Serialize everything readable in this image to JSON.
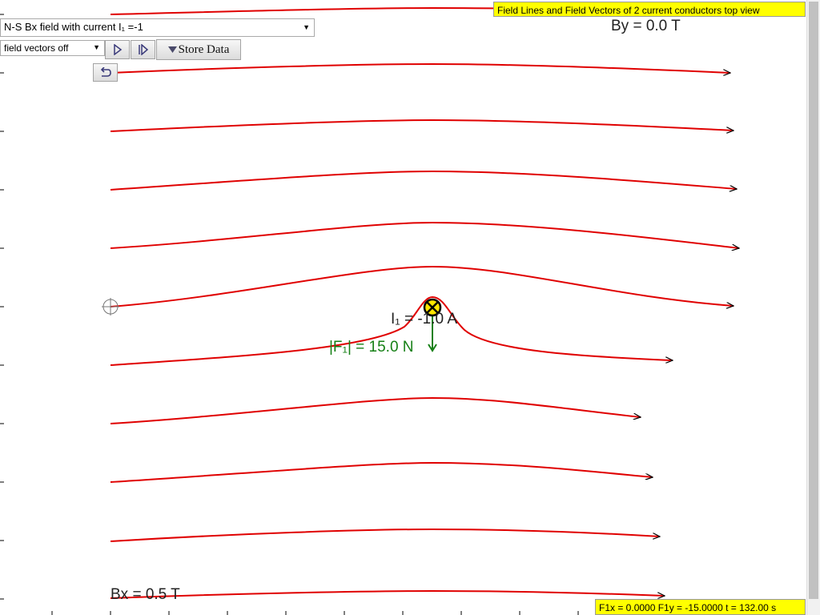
{
  "title_box": "Field Lines and Field Vectors of 2 current conductors top view",
  "scenario_select": {
    "selected": "N-S Bx field with current I₁ =-1"
  },
  "vector_select": {
    "selected": "field vectors off"
  },
  "store_button": {
    "label": "Store Data"
  },
  "icons": {
    "play": "play-icon",
    "step": "step-forward-icon",
    "reset": "undo-icon",
    "dropdown": "triangle-down-icon",
    "conductor": "current-into-page-icon",
    "origin": "crosshair-icon"
  },
  "readouts": {
    "by": "By = 0.0 T",
    "bx": "Bx = 0.5 T",
    "current": "I₁ = -1.0 A",
    "force": "|F₁| = 15.0 N",
    "status": "F1x = 0.0000 F1y = -15.0000 t = 132.00 s"
  },
  "colors": {
    "field_line": "#e00000",
    "force_vector": "#168016",
    "conductor_fill": "#ffe600",
    "info_box": "#ffff00"
  }
}
